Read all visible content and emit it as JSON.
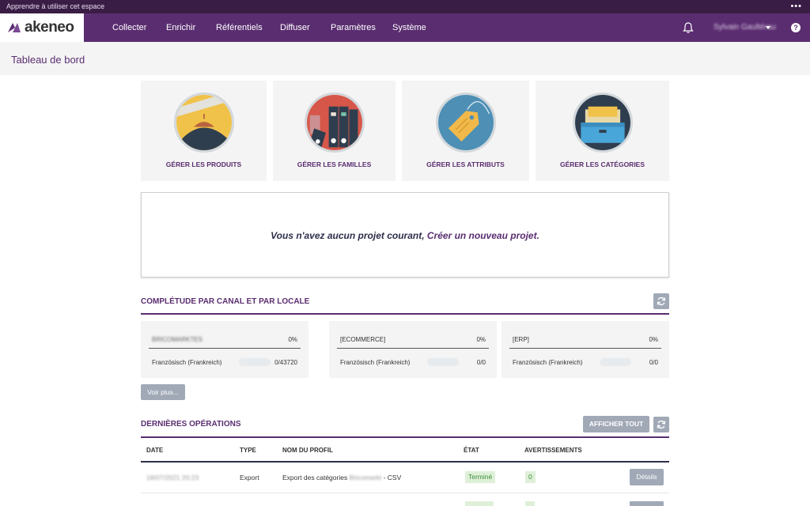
{
  "top_strip": {
    "text": "Apprendre à utiliser cet espace",
    "menu": "•••"
  },
  "brand": {
    "name": "akeneo",
    "color": "#5a2d70"
  },
  "nav": {
    "items": [
      "Collecter",
      "Enrichir",
      "Référentiels",
      "Diffuser",
      "Paramètres",
      "Système"
    ],
    "user": "Sylvain Gaultérau",
    "help": "?"
  },
  "page": {
    "title": "Tableau de bord"
  },
  "tiles": [
    {
      "label": "GÉRER LES PRODUITS",
      "icon": "hanger-icon"
    },
    {
      "label": "GÉRER LES FAMILLES",
      "icon": "binders-icon"
    },
    {
      "label": "GÉRER LES ATTRIBUTS",
      "icon": "tag-icon"
    },
    {
      "label": "GÉRER LES CATÉGORIES",
      "icon": "drawer-icon"
    }
  ],
  "project": {
    "text": "Vous n'avez aucun projet courant, ",
    "link": "Créer un nouveau projet."
  },
  "completeness": {
    "title": "COMPLÉTUDE PAR CANAL ET PAR LOCALE",
    "channels": [
      {
        "name": "BRICOMARKTES",
        "percent": "0%",
        "locale": "Französisch (Frankreich)",
        "count": "0/43720"
      },
      {
        "name": "[ECOMMERCE]",
        "percent": "0%",
        "locale": "Französisch (Frankreich)",
        "count": "0/0"
      },
      {
        "name": "[ERP]",
        "percent": "0%",
        "locale": "Französisch (Frankreich)",
        "count": "0/0"
      }
    ],
    "more_button": "Voir plus..."
  },
  "operations": {
    "title": "DERNIÈRES OPÉRATIONS",
    "show_all": "AFFICHER TOUT",
    "columns": [
      "DATE",
      "TYPE",
      "NOM DU PROFIL",
      "ÉTAT",
      "AVERTISSEMENTS"
    ],
    "rows": [
      {
        "date": "18/07/2021 20:23",
        "type": "Export",
        "profile_prefix": "Export des catégories",
        "profile_blur": "Bricomarkt",
        "profile_suffix": " - CSV",
        "status": "Terminé",
        "warnings": "0",
        "action": "Détails"
      }
    ]
  }
}
